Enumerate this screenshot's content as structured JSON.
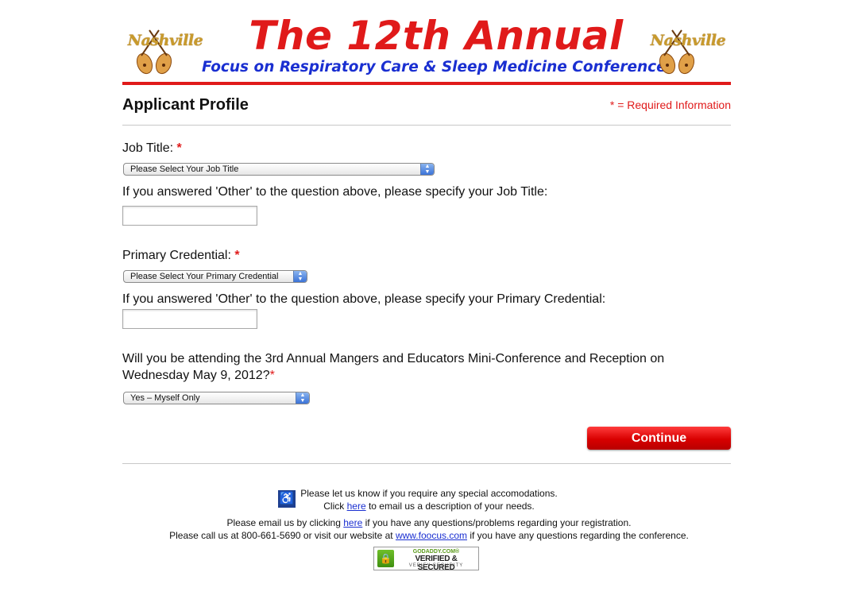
{
  "banner": {
    "logo_text": "Nashville",
    "title": "The 12th Annual",
    "subtitle": "Focus on Respiratory Care & Sleep Medicine Conference"
  },
  "profile": {
    "title": "Applicant Profile",
    "required_note": "* = Required Information"
  },
  "form": {
    "job_title": {
      "label": "Job Title:",
      "required_mark": "*",
      "selected": "Please Select Your Job Title",
      "other_prompt": "If you answered 'Other' to the question above, please specify your Job Title:",
      "other_value": ""
    },
    "primary_credential": {
      "label": "Primary Credential:",
      "required_mark": "*",
      "selected": "Please Select Your Primary Credential",
      "other_prompt": "If you answered 'Other' to the question above, please specify your Primary Credential:",
      "other_value": ""
    },
    "mini_conference": {
      "question_line1": "Will you be attending the 3rd Annual Mangers and Educators Mini-Conference and Reception on",
      "question_line2": "Wednesday May 9, 2012?",
      "required_mark": "*",
      "selected": "Yes – Myself Only"
    },
    "continue_label": "Continue"
  },
  "footer": {
    "accommodations_line": "Please let us know if you require any special accomodations.",
    "click_prefix": "Click",
    "click_link": "here",
    "click_suffix": "to email us a description of your needs.",
    "email_prefix": "Please email us by clicking",
    "email_link": "here",
    "email_suffix": "if you have any questions/problems regarding your registration.",
    "call_prefix": "Please call us at 800-661-5690 or visit our website at",
    "website_link": "www.foocus.com",
    "call_suffix": "if you have any questions regarding the conference.",
    "seal": {
      "top": "GODADDY.COM®",
      "main": "VERIFIED & SECURED",
      "sub": "VERIFY SECURITY"
    }
  },
  "colors": {
    "accent_red": "#e01a1a",
    "subtitle_blue": "#1a2fd1",
    "logo_gold": "#c89a2c"
  },
  "icons": [
    "mandolin-icon",
    "wheelchair-icon",
    "lock-icon",
    "updown-arrows-icon"
  ]
}
